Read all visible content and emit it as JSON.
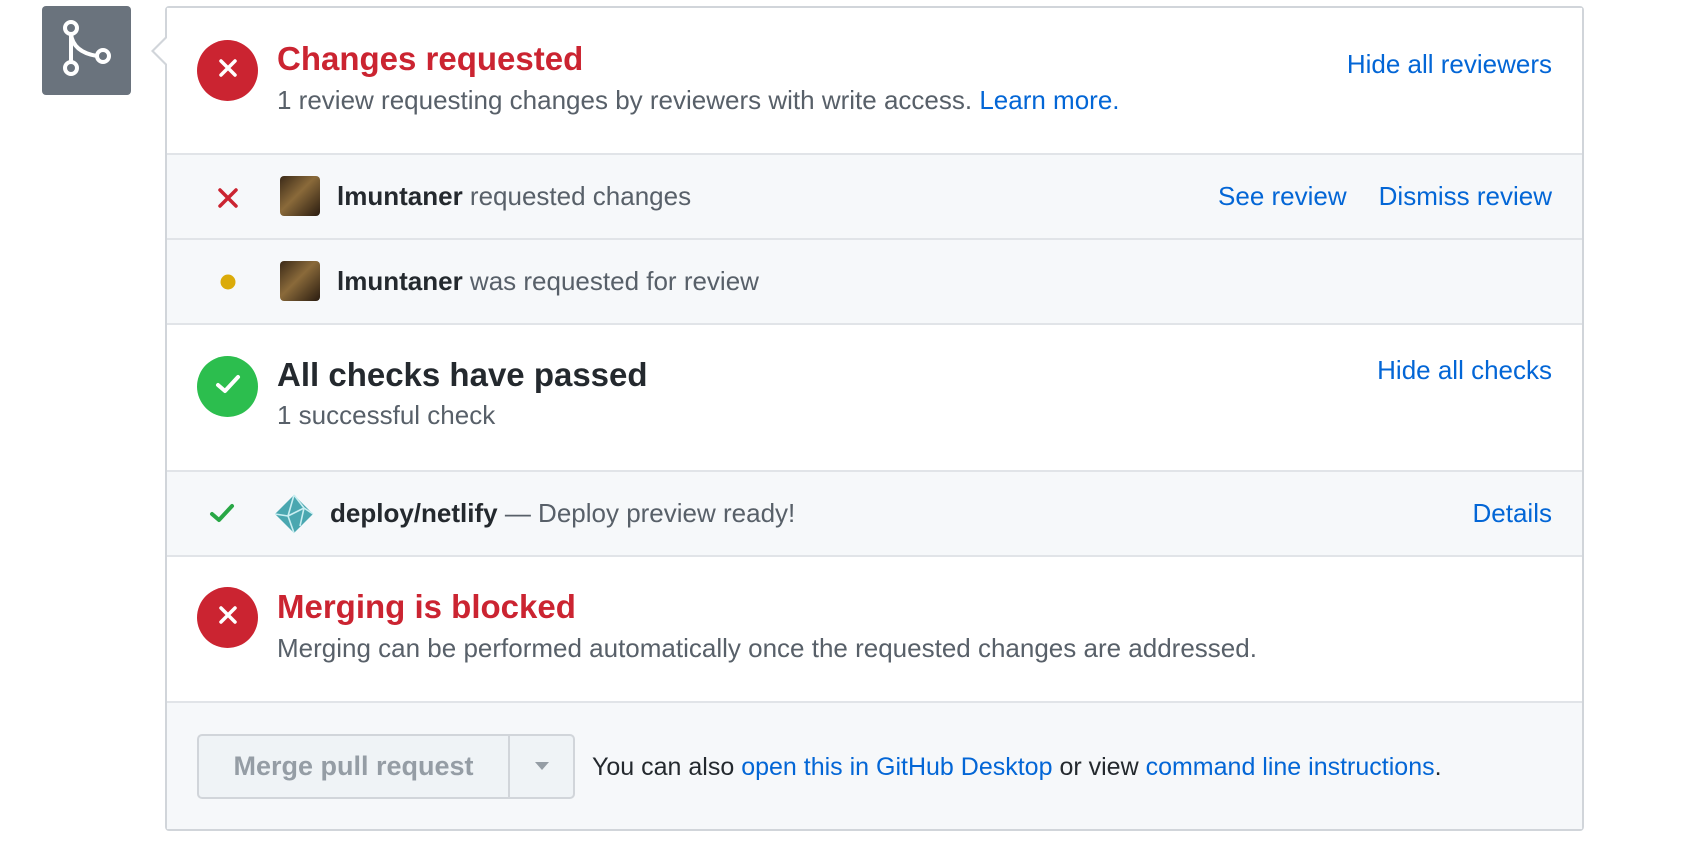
{
  "badge": {
    "icon": "git-merge-icon"
  },
  "reviews": {
    "title": "Changes requested",
    "description": "1 review requesting changes by reviewers with write access.",
    "learn_more": "Learn more.",
    "toggle": "Hide all reviewers",
    "status_color": "#cb2431"
  },
  "review_rows": [
    {
      "user": "lmuntaner",
      "action": "requested changes",
      "icon": "x-icon",
      "see_review": "See review",
      "dismiss_review": "Dismiss review"
    },
    {
      "user": "lmuntaner",
      "action": "was requested for review",
      "icon": "pending-dot-icon"
    }
  ],
  "checks": {
    "title": "All checks have passed",
    "description": "1 successful check",
    "toggle": "Hide all checks",
    "status_color": "#2cbe4e"
  },
  "check_rows": [
    {
      "name": "deploy/netlify",
      "message": "— Deploy preview ready!",
      "icon": "check-icon",
      "details": "Details"
    }
  ],
  "merge_status": {
    "title": "Merging is blocked",
    "description": "Merging can be performed automatically once the requested changes are addressed."
  },
  "merge": {
    "button_label": "Merge pull request",
    "hint_prefix": "You can also",
    "desktop_link": "open this in GitHub Desktop",
    "hint_middle": "or view",
    "cli_link": "command line instructions",
    "hint_suffix": "."
  }
}
